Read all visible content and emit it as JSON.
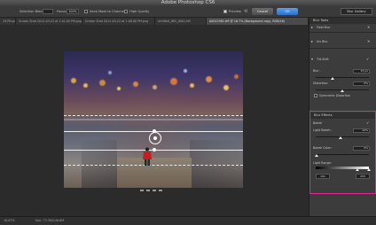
{
  "window": {
    "title": "Adobe Photoshop CS6"
  },
  "options_bar": {
    "selection_bleed_label": "Selection Bleed:",
    "focus_label": "Focus:",
    "focus_value": "100%",
    "save_mask_label": "Save Mask to Channels",
    "high_quality_label": "High Quality",
    "preview_label": "Preview",
    "cancel_label": "Cancel",
    "ok_label": "OK",
    "workspace": "Blur Gallery"
  },
  "tabs": [
    {
      "label": "29.PN.png"
    },
    {
      "label": "Screen Shot 2012-03-22 at 1.41.05 PM.png"
    },
    {
      "label": "Screen Shot 2012-03-22 at 1.08.00 PM.png"
    },
    {
      "label": "Untitled_IMG_0001.tiff"
    },
    {
      "label": "A0012981.tiff @ 16.7% (Background copy, RGB/16)"
    }
  ],
  "status_bar": {
    "zoom": "16.67%",
    "doc_size": "Doc: 73.3M/146.6M"
  },
  "panel": {
    "title": "Blur Tools",
    "field_blur": {
      "label": "Field Blur"
    },
    "iris_blur": {
      "label": "Iris Blur"
    },
    "tilt_shift": {
      "label": "Tilt-Shift",
      "blur_label": "Blur:",
      "blur_value": "15 px",
      "distortion_label": "Distortion:",
      "distortion_value": "0%",
      "symmetric_label": "Symmetric Distortion"
    },
    "blur_effects": {
      "title": "Blur Effects",
      "bokeh_label": "Bokeh",
      "light_bokeh_label": "Light Bokeh:",
      "light_bokeh_value": "44%",
      "bokeh_color_label": "Bokeh Color:",
      "bokeh_color_value": "0%",
      "light_range_label": "Light Range:",
      "light_range_min": "191",
      "light_range_max": "255"
    }
  },
  "colors": {
    "highlight_border": "#e0249a",
    "ok_button": "#2f6fc8"
  },
  "icons": {
    "focus_pin": "focus-pin-icon",
    "person": "person-icon",
    "collapse": "triangle-icon",
    "close": "close-icon",
    "checkmark": "checkmark-icon"
  }
}
